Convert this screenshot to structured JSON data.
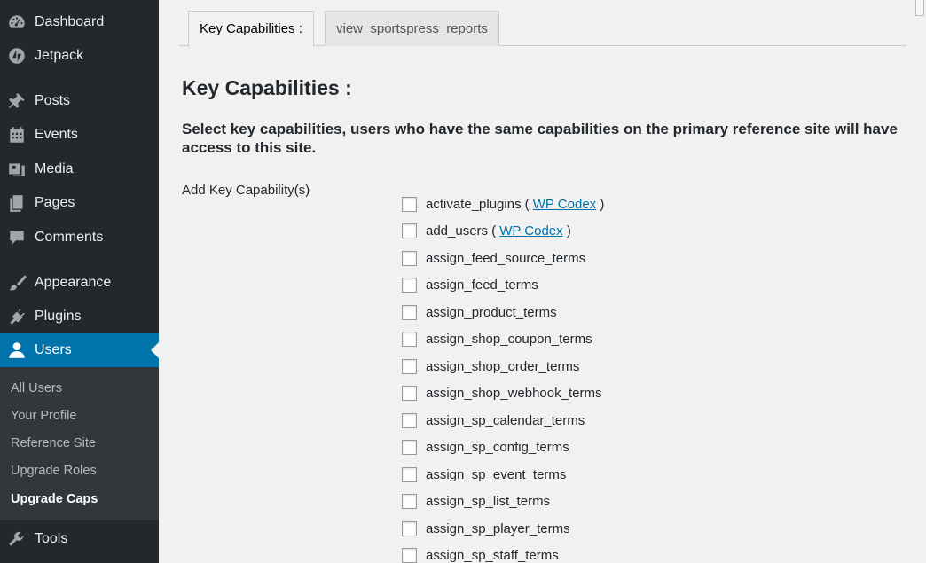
{
  "sidebar": {
    "items": [
      {
        "label": "Dashboard",
        "icon": "dashboard-icon"
      },
      {
        "label": "Jetpack",
        "icon": "jetpack-icon"
      },
      {
        "label": "Posts",
        "icon": "pushpin-icon"
      },
      {
        "label": "Events",
        "icon": "calendar-icon"
      },
      {
        "label": "Media",
        "icon": "media-icon"
      },
      {
        "label": "Pages",
        "icon": "pages-icon"
      },
      {
        "label": "Comments",
        "icon": "comment-icon"
      },
      {
        "label": "Appearance",
        "icon": "paintbrush-icon"
      },
      {
        "label": "Plugins",
        "icon": "plug-icon"
      },
      {
        "label": "Users",
        "icon": "user-icon",
        "active": true
      },
      {
        "label": "Tools",
        "icon": "wrench-icon"
      }
    ],
    "submenu": [
      {
        "label": "All Users"
      },
      {
        "label": "Your Profile"
      },
      {
        "label": "Reference Site"
      },
      {
        "label": "Upgrade Roles"
      },
      {
        "label": "Upgrade Caps",
        "current": true
      }
    ]
  },
  "tabs": [
    {
      "label": "Key Capabilities :",
      "active": true
    },
    {
      "label": "view_sportspress_reports",
      "active": false
    }
  ],
  "main": {
    "title": "Key Capabilities :",
    "intro": "Select key capabilities, users who have the same capabilities on the primary reference site will have access to this site.",
    "field_label": "Add Key Capability(s)",
    "codex_label": "WP Codex",
    "capabilities": [
      {
        "name": "activate_plugins",
        "codex": true,
        "checked": false
      },
      {
        "name": "add_users",
        "codex": true,
        "checked": false
      },
      {
        "name": "assign_feed_source_terms",
        "codex": false,
        "checked": false
      },
      {
        "name": "assign_feed_terms",
        "codex": false,
        "checked": false
      },
      {
        "name": "assign_product_terms",
        "codex": false,
        "checked": false
      },
      {
        "name": "assign_shop_coupon_terms",
        "codex": false,
        "checked": false
      },
      {
        "name": "assign_shop_order_terms",
        "codex": false,
        "checked": false
      },
      {
        "name": "assign_shop_webhook_terms",
        "codex": false,
        "checked": false
      },
      {
        "name": "assign_sp_calendar_terms",
        "codex": false,
        "checked": false
      },
      {
        "name": "assign_sp_config_terms",
        "codex": false,
        "checked": false
      },
      {
        "name": "assign_sp_event_terms",
        "codex": false,
        "checked": false
      },
      {
        "name": "assign_sp_list_terms",
        "codex": false,
        "checked": false
      },
      {
        "name": "assign_sp_player_terms",
        "codex": false,
        "checked": false
      },
      {
        "name": "assign_sp_staff_terms",
        "codex": false,
        "checked": false
      }
    ]
  },
  "colors": {
    "sidebar_bg": "#23282d",
    "submenu_bg": "#32373c",
    "accent": "#0073aa",
    "page_bg": "#f1f1f1"
  }
}
